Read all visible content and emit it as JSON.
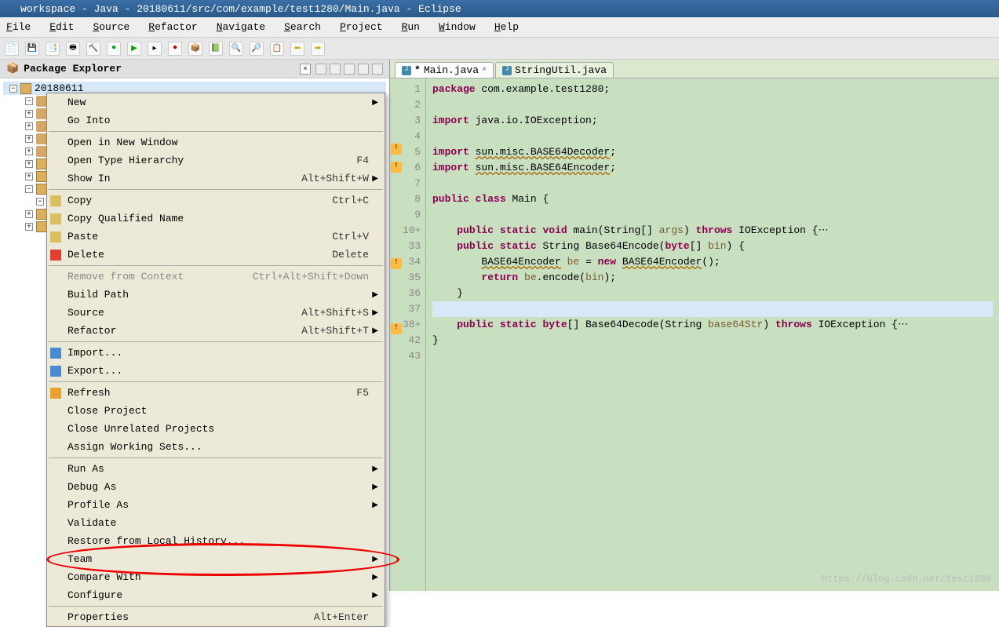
{
  "title": "workspace - Java - 20180611/src/com/example/test1280/Main.java - Eclipse",
  "menus": [
    "File",
    "Edit",
    "Source",
    "Refactor",
    "Navigate",
    "Search",
    "Project",
    "Run",
    "Window",
    "Help"
  ],
  "package_explorer": {
    "title": "Package Explorer"
  },
  "tree_root": "20180611",
  "context_menu": [
    {
      "type": "item",
      "label": "New",
      "arrow": true
    },
    {
      "type": "item",
      "label": "Go Into"
    },
    {
      "type": "sep"
    },
    {
      "type": "item",
      "label": "Open in New Window"
    },
    {
      "type": "item",
      "label": "Open Type Hierarchy",
      "sc": "F4"
    },
    {
      "type": "item",
      "label": "Show In",
      "sc": "Alt+Shift+W",
      "arrow": true
    },
    {
      "type": "sep"
    },
    {
      "type": "item",
      "label": "Copy",
      "sc": "Ctrl+C",
      "icon": "#d8c060"
    },
    {
      "type": "item",
      "label": "Copy Qualified Name",
      "icon": "#d8c060"
    },
    {
      "type": "item",
      "label": "Paste",
      "sc": "Ctrl+V",
      "icon": "#d8c060"
    },
    {
      "type": "item",
      "label": "Delete",
      "sc": "Delete",
      "icon": "#e04030"
    },
    {
      "type": "sep"
    },
    {
      "type": "item",
      "label": "Remove from Context",
      "sc": "Ctrl+Alt+Shift+Down",
      "disabled": true
    },
    {
      "type": "item",
      "label": "Build Path",
      "arrow": true
    },
    {
      "type": "item",
      "label": "Source",
      "sc": "Alt+Shift+S",
      "arrow": true
    },
    {
      "type": "item",
      "label": "Refactor",
      "sc": "Alt+Shift+T",
      "arrow": true
    },
    {
      "type": "sep"
    },
    {
      "type": "item",
      "label": "Import...",
      "icon": "#4a8ad0"
    },
    {
      "type": "item",
      "label": "Export...",
      "icon": "#4a8ad0"
    },
    {
      "type": "sep"
    },
    {
      "type": "item",
      "label": "Refresh",
      "sc": "F5",
      "icon": "#e8a030"
    },
    {
      "type": "item",
      "label": "Close Project"
    },
    {
      "type": "item",
      "label": "Close Unrelated Projects"
    },
    {
      "type": "item",
      "label": "Assign Working Sets..."
    },
    {
      "type": "sep"
    },
    {
      "type": "item",
      "label": "Run As",
      "arrow": true
    },
    {
      "type": "item",
      "label": "Debug As",
      "arrow": true
    },
    {
      "type": "item",
      "label": "Profile As",
      "arrow": true
    },
    {
      "type": "item",
      "label": "Validate"
    },
    {
      "type": "item",
      "label": "Restore from Local History..."
    },
    {
      "type": "item",
      "label": "Team",
      "arrow": true
    },
    {
      "type": "item",
      "label": "Compare With",
      "arrow": true
    },
    {
      "type": "item",
      "label": "Configure",
      "arrow": true
    },
    {
      "type": "sep"
    },
    {
      "type": "item",
      "label": "Properties",
      "sc": "Alt+Enter"
    }
  ],
  "tabs": [
    {
      "label": "Main.java",
      "dirty": "*",
      "active": true
    },
    {
      "label": "StringUtil.java",
      "active": false
    }
  ],
  "code_lines": [
    {
      "n": 1,
      "html": "<span class='kw'>package</span> com.example.test1280;"
    },
    {
      "n": 2,
      "html": ""
    },
    {
      "n": 3,
      "html": "<span class='kw'>import</span> java.io.IOException;"
    },
    {
      "n": 4,
      "html": ""
    },
    {
      "n": 5,
      "html": "<span class='kw'>import</span> <span class='wavy'>sun.misc.BASE64Decoder</span>;",
      "marker": "warn"
    },
    {
      "n": 6,
      "html": "<span class='kw'>import</span> <span class='wavy'>sun.misc.BASE64Encoder</span>;",
      "marker": "warn"
    },
    {
      "n": 7,
      "html": ""
    },
    {
      "n": 8,
      "html": "<span class='kw'>public</span> <span class='kw'>class</span> Main {"
    },
    {
      "n": 9,
      "html": ""
    },
    {
      "n": 10,
      "html": "    <span class='kw'>public</span> <span class='kw'>static</span> <span class='kw'>void</span> main(String[] <span class='par'>args</span>) <span class='kw'>throws</span> IOException {⋯",
      "fold": "+"
    },
    {
      "n": 33,
      "html": "    <span class='kw'>public</span> <span class='kw'>static</span> String Base64Encode(<span class='kw'>byte</span>[] <span class='par'>bin</span>) {"
    },
    {
      "n": 34,
      "html": "        <span class='wavy'>BASE64Encoder</span> <span class='par'>be</span> = <span class='kw'>new</span> <span class='wavy'>BASE64Encoder</span>();",
      "marker": "warn"
    },
    {
      "n": 35,
      "html": "        <span class='kw'>return</span> <span class='par'>be</span>.encode(<span class='par'>bin</span>);"
    },
    {
      "n": 36,
      "html": "    }"
    },
    {
      "n": 37,
      "html": "",
      "highlight": true
    },
    {
      "n": 38,
      "html": "    <span class='kw'>public</span> <span class='kw'>static</span> <span class='kw'>byte</span>[] Base64Decode(String <span class='par'>base64Str</span>) <span class='kw'>throws</span> IOException {⋯",
      "fold": "+",
      "marker": "warn"
    },
    {
      "n": 42,
      "html": "}"
    },
    {
      "n": 43,
      "html": ""
    }
  ],
  "watermark": "https://blog.csdn.net/test1280"
}
